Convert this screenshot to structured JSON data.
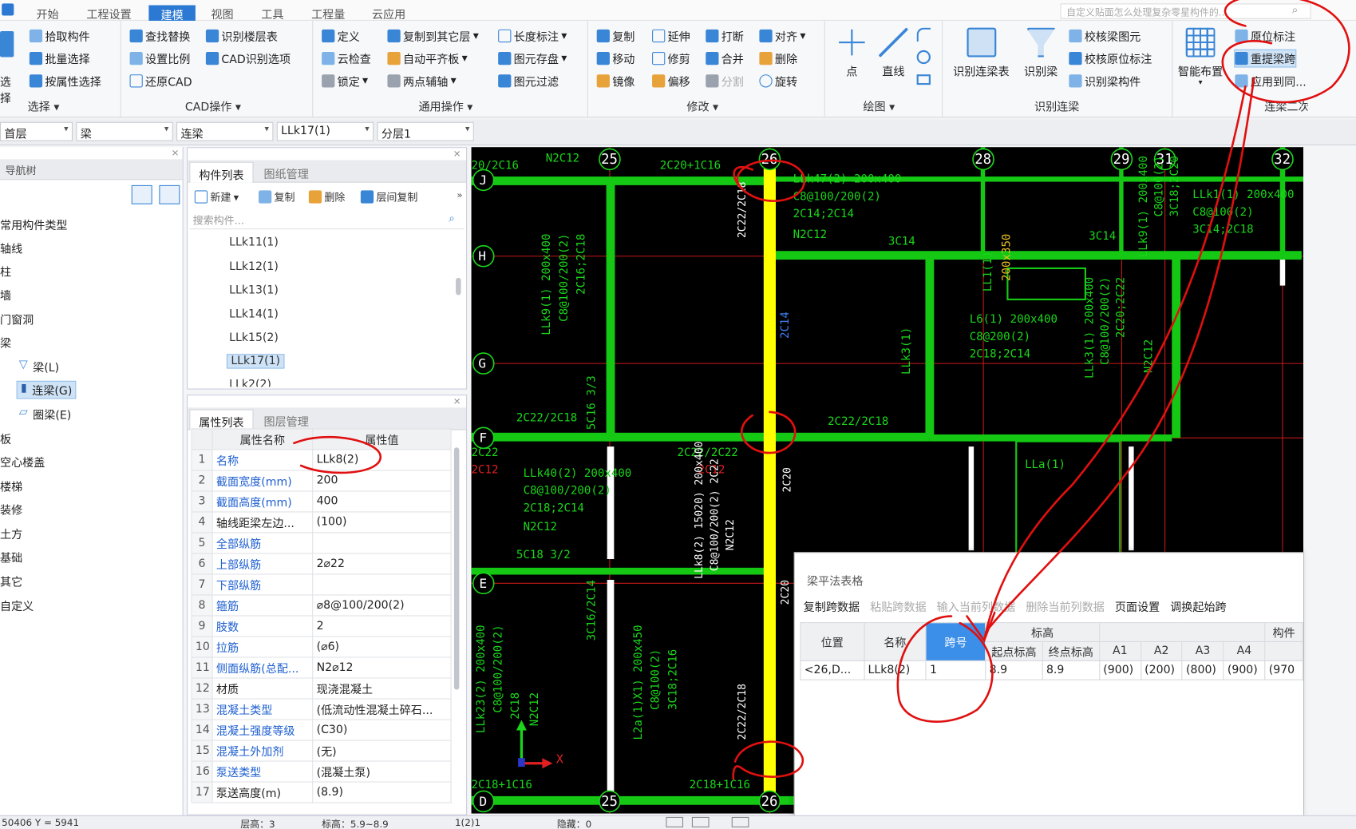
{
  "menu": {
    "tabs": [
      "开始",
      "工程设置",
      "建模",
      "视图",
      "工具",
      "工程量",
      "云应用"
    ],
    "search_placeholder": "自定义贴面怎么处理复杂零星构件的..."
  },
  "ribbon": {
    "select": {
      "title": "选择",
      "pick": "拾取构件",
      "batch": "批量选择",
      "by_attr": "按属性选择",
      "big": "选择"
    },
    "cad": {
      "title": "CAD操作",
      "find_replace": "查找替换",
      "set_scale": "设置比例",
      "restore_cad": "还原CAD",
      "recog_floor": "识别楼层表",
      "cad_options": "CAD识别选项"
    },
    "common": {
      "title": "通用操作",
      "define": "定义",
      "cloud_check": "云检查",
      "lock": "锁定",
      "copy_to_floor": "复制到其它层",
      "auto_flat": "自动平齐板",
      "two_point_axis": "两点辅轴",
      "length_mark": "长度标注",
      "elem_store": "图元存盘",
      "elem_filter": "图元过滤"
    },
    "modify": {
      "title": "修改",
      "copy": "复制",
      "move": "移动",
      "mirror": "镜像",
      "extend": "延伸",
      "trim": "修剪",
      "offset": "偏移",
      "break": "打断",
      "merge": "合并",
      "split": "分割",
      "align": "对齐",
      "delete": "删除",
      "rotate": "旋转"
    },
    "draw": {
      "title": "绘图",
      "point": "点",
      "line": "直线"
    },
    "recog": {
      "title": "识别连梁",
      "recog_table": "识别连梁表",
      "recog_beam": "识别梁",
      "check_beam_elem": "校核梁图元",
      "check_orig_mark": "校核原位标注",
      "recog_beam_comp": "识别梁构件"
    },
    "beam2": {
      "title": "连梁二次编辑",
      "smart_layout": "智能布置",
      "orig_mark": "原位标注",
      "re_span": "重提梁跨",
      "apply_same": "应用到同..."
    }
  },
  "selectors": [
    "首层",
    "梁",
    "连梁",
    "LLk17(1)",
    "分层1"
  ],
  "nav": {
    "header": "导航树",
    "items": [
      "常用构件类型",
      "轴线",
      "柱",
      "墙",
      "门窗洞",
      "梁",
      "梁(L)",
      "连梁(G)",
      "圈梁(E)",
      "板",
      "空心楼盖",
      "楼梯",
      "装修",
      "土方",
      "基础",
      "其它",
      "自定义"
    ]
  },
  "comp_list": {
    "tabs": [
      "构件列表",
      "图纸管理"
    ],
    "tools": {
      "new": "新建",
      "copy": "复制",
      "delete": "删除",
      "floor_copy": "层间复制"
    },
    "search_placeholder": "搜索构件...",
    "items": [
      "LLk11(1)",
      "LLk12(1)",
      "LLk13(1)",
      "LLk14(1)",
      "LLk15(2)",
      "LLk17(1)",
      "LLk2(2)"
    ],
    "selected": "LLk17(1)"
  },
  "props": {
    "tabs": [
      "属性列表",
      "图层管理"
    ],
    "col_name": "属性名称",
    "col_value": "属性值",
    "rows": [
      {
        "n": "1",
        "name": "名称",
        "value": "LLk8(2)"
      },
      {
        "n": "2",
        "name": "截面宽度(mm)",
        "value": "200"
      },
      {
        "n": "3",
        "name": "截面高度(mm)",
        "value": "400"
      },
      {
        "n": "4",
        "name": "轴线距梁左边...",
        "value": "(100)"
      },
      {
        "n": "5",
        "name": "全部纵筋",
        "value": ""
      },
      {
        "n": "6",
        "name": "上部纵筋",
        "value": "2⌀22"
      },
      {
        "n": "7",
        "name": "下部纵筋",
        "value": ""
      },
      {
        "n": "8",
        "name": "箍筋",
        "value": "⌀8@100/200(2)"
      },
      {
        "n": "9",
        "name": "肢数",
        "value": "2"
      },
      {
        "n": "10",
        "name": "拉筋",
        "value": "(⌀6)"
      },
      {
        "n": "11",
        "name": "侧面纵筋(总配...",
        "value": "N2⌀12"
      },
      {
        "n": "12",
        "name": "材质",
        "value": "现浇混凝土"
      },
      {
        "n": "13",
        "name": "混凝土类型",
        "value": "(低流动性混凝土碎石..."
      },
      {
        "n": "14",
        "name": "混凝土强度等级",
        "value": "(C30)"
      },
      {
        "n": "15",
        "name": "混凝土外加剂",
        "value": "(无)"
      },
      {
        "n": "16",
        "name": "泵送类型",
        "value": "(混凝土泵)"
      },
      {
        "n": "17",
        "name": "泵送高度(m)",
        "value": "(8.9)"
      }
    ]
  },
  "canvas": {
    "axes_top": [
      "25",
      "26",
      "28",
      "29",
      "31",
      "32"
    ],
    "axes_left": [
      "J",
      "H",
      "G",
      "F",
      "E",
      "D"
    ],
    "axes_bottom": [
      "25",
      "26"
    ],
    "labels": {
      "t1": "20/2C16",
      "t2": "N2C12",
      "t3": "2C20+1C16",
      "t4": "LLk47(2) 200x400",
      "t5": "C8@100/200(2)",
      "t6": "2C14;2C14",
      "t7": "N2C12",
      "t8": "3C14",
      "t9": "3C14",
      "t10": "LLk9(1) 200x400",
      "t11": "LLk1(1) 200x400",
      "t12": "C8@100(2)",
      "t13": "3C14;2C18",
      "t14": "L6(1) 200x400",
      "t15": "C8@200(2)",
      "t16": "2C18;2C14",
      "t17": "2C22/2C18",
      "t18": "2C22/2C18",
      "t19": "2C22",
      "t20": "2C12",
      "t21": "LLk40(2) 200x400",
      "t22": "C8@100/200(2)",
      "t23": "2C18;2C14",
      "t24": "N2C12",
      "t25": "5C18 3/2",
      "t26": "2C18+1C16",
      "t27": "2C18+1C16",
      "t28": "LLa(1)",
      "t29": "200x350",
      "t30": "2C22/2C22",
      "t31": "2C12",
      "v1": "2C22/2C18",
      "v2": "2C14",
      "v3": "2C20",
      "v4": "LLk9(1) 200x400",
      "v5": "C8@100/200(2)",
      "v6": "2C16;2C18",
      "v7": "LLk8(2) 15020) 200x400",
      "v8": "C8@100/200(2) 2C22",
      "v9": "N2C12",
      "v10": "LLk3(1)",
      "v11": "LLk3(1) 200x400",
      "v12": "C8@100/200(2)",
      "v13": "2C20;2C22",
      "v14": "N2C12",
      "v15": "5C16 3/3",
      "v16": "3C16/2C14",
      "v17": "LLk23(2) 200x400",
      "v18": "C8@100/200(2)",
      "v19": "2C18",
      "v20": "N2C12",
      "v21": "L2a(1)X1) 200x450",
      "v22": "C8@100(2)",
      "v23": "3C18;2C16",
      "v24": "2C22/2C18",
      "v25": "2C20",
      "v26": "LLk5(1) 200x400",
      "v27": "C8@100/200(2)",
      "v28": "2C14;2C14",
      "v29": "LL1(1)",
      "v30": "C8@100(2)",
      "v31": "2C14;2C14",
      "v32": "LLk9(1) 200x400",
      "v33": "C8@100(2)",
      "v34": "3C18;2C20"
    },
    "ucs_x": "X"
  },
  "dialog": {
    "title": "梁平法表格",
    "tools": [
      "复制跨数据",
      "粘贴跨数据",
      "输入当前列数据",
      "删除当前列数据",
      "页面设置",
      "调换起始跨"
    ],
    "headers": {
      "pos": "位置",
      "name": "名称",
      "span": "跨号",
      "elev": "标高",
      "start_elev": "起点标高",
      "end_elev": "终点标高",
      "a1": "A1",
      "a2": "A2",
      "a3": "A3",
      "a4": "A4",
      "comp": "构件"
    },
    "row": {
      "idx": "1",
      "pos": "<26,D...",
      "name": "LLk8(2)",
      "span": "1",
      "start": "8.9",
      "end": "8.9",
      "a1": "(900)",
      "a2": "(200)",
      "a3": "(800)",
      "a4": "(900)",
      "a5": "(970"
    }
  },
  "status": {
    "coords": "50406 Y = 5941",
    "floor": "层高：3",
    "elev": "标高：5.9~8.9",
    "scale": "1(2)1",
    "hidden": "隐藏：0"
  },
  "colors": {
    "accent": "#2b79d3",
    "beam_green": "#1bd61b",
    "beam_yellow": "#ffff00",
    "axis_red": "#d42020",
    "annot_red": "#e01010"
  }
}
